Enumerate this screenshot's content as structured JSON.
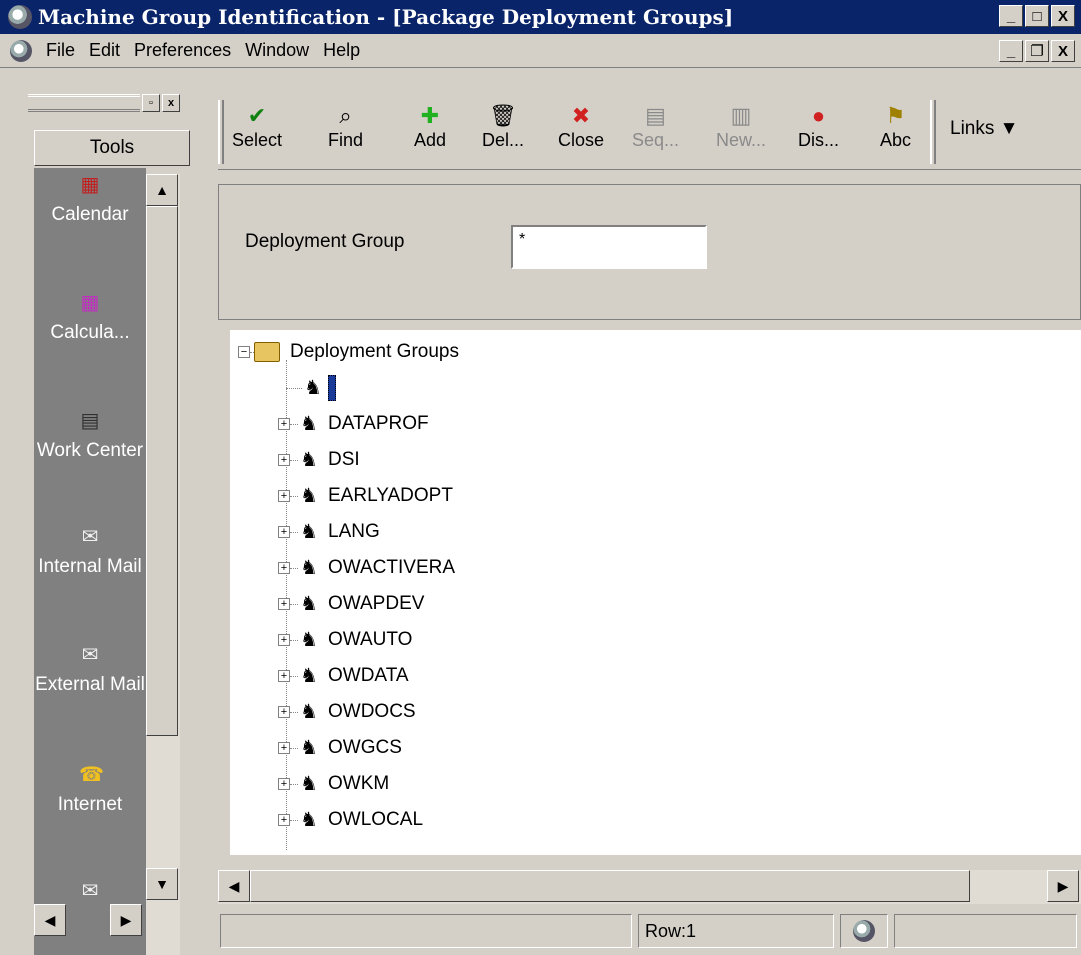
{
  "window": {
    "title": "Machine Group Identification - [Package Deployment Groups]",
    "controls": [
      "_",
      "□",
      "X"
    ],
    "mdi_controls": [
      "_",
      "ð",
      "X"
    ]
  },
  "menu": [
    "File",
    "Edit",
    "Preferences",
    "Window",
    "Help"
  ],
  "sidebar": {
    "header": "Tools",
    "items": [
      {
        "label": "Calendar",
        "icon": "calendar-icon"
      },
      {
        "label": "Calcula...",
        "icon": "calculator-icon"
      },
      {
        "label": "Work Center",
        "icon": "work-center-icon"
      },
      {
        "label": "Internal Mail",
        "icon": "envelope-icon"
      },
      {
        "label": "External Mail",
        "icon": "envelope-icon"
      },
      {
        "label": "Internet",
        "icon": "phone-icon"
      }
    ]
  },
  "toolbar": {
    "buttons": [
      {
        "label": "Select",
        "icon": "checkmark-icon",
        "disabled": false
      },
      {
        "label": "Find",
        "icon": "find-icon",
        "disabled": false
      },
      {
        "label": "Add",
        "icon": "plus-icon",
        "disabled": false
      },
      {
        "label": "Del...",
        "icon": "trash-icon",
        "disabled": false
      },
      {
        "label": "Close",
        "icon": "close-icon",
        "disabled": false
      },
      {
        "label": "Seq...",
        "icon": "document-icon",
        "disabled": true
      },
      {
        "label": "New...",
        "icon": "new-icon",
        "disabled": true
      },
      {
        "label": "Dis...",
        "icon": "display-icon",
        "disabled": false
      },
      {
        "label": "Abc",
        "icon": "abc-icon",
        "disabled": false
      }
    ],
    "links_label": "Links"
  },
  "form": {
    "label": "Deployment Group",
    "value": "*"
  },
  "tree": {
    "root": "Deployment Groups",
    "children": [
      "",
      "DATAPROF",
      "DSI",
      "EARLYADOPT",
      "LANG",
      "OWACTIVERA",
      "OWAPDEV",
      "OWAUTO",
      "OWDATA",
      "OWDOCS",
      "OWGCS",
      "OWKM",
      "OWLOCAL"
    ]
  },
  "status": {
    "row": "Row:1"
  }
}
